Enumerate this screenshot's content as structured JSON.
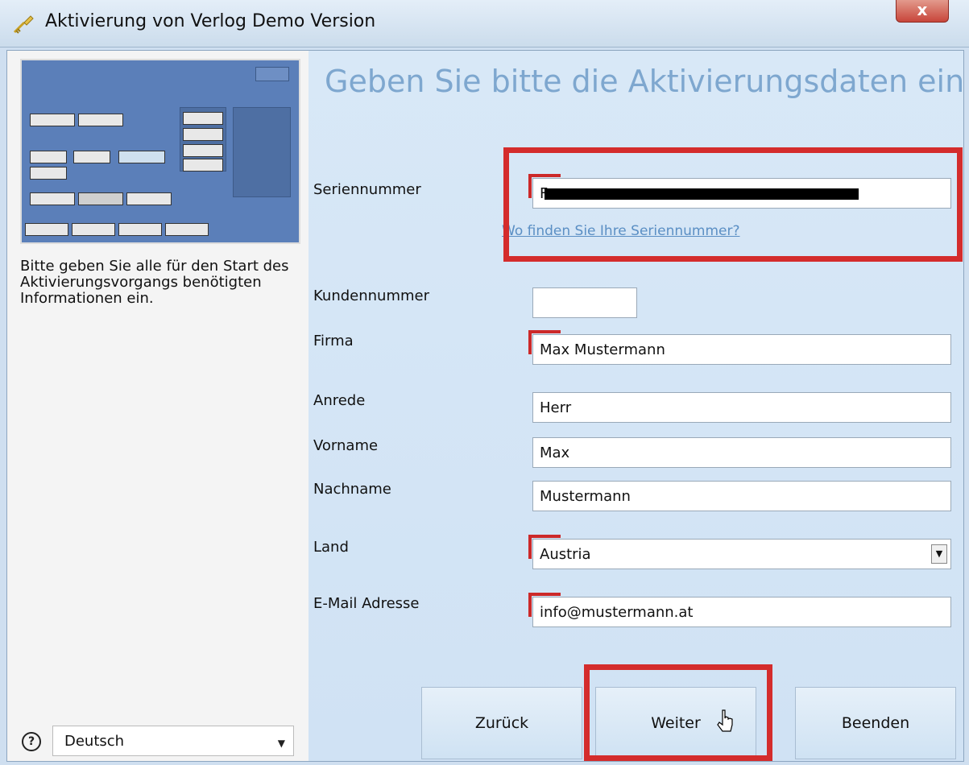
{
  "window": {
    "title": "Aktivierung von Verlog Demo Version",
    "close_label": "x"
  },
  "left": {
    "description": "Bitte geben Sie alle für den Start des Aktivierungsvorgangs benötigten Informationen ein.",
    "language_icon": "question-mark-icon",
    "language_value": "Deutsch"
  },
  "main": {
    "heading": "Geben Sie bitte die Aktivierungsdaten ein",
    "serial": {
      "label": "Seriennummer",
      "value": "F"
    },
    "serial_link": "Wo finden Sie Ihre Seriennummer?",
    "kundennummer": {
      "label": "Kundennummer",
      "value": ""
    },
    "firma": {
      "label": "Firma",
      "value": "Max Mustermann"
    },
    "anrede": {
      "label": "Anrede",
      "value": "Herr"
    },
    "vorname": {
      "label": "Vorname",
      "value": "Max"
    },
    "nachname": {
      "label": "Nachname",
      "value": "Mustermann"
    },
    "land": {
      "label": "Land",
      "value": "Austria"
    },
    "email": {
      "label": "E-Mail Adresse",
      "value": "info@mustermann.at"
    }
  },
  "buttons": {
    "back": "Zurück",
    "next": "Weiter",
    "finish": "Beenden"
  },
  "colors": {
    "required_marker": "#cc2929",
    "highlight": "#d42c2c",
    "heading": "#7ea7cf",
    "link": "#5b8fc4"
  }
}
